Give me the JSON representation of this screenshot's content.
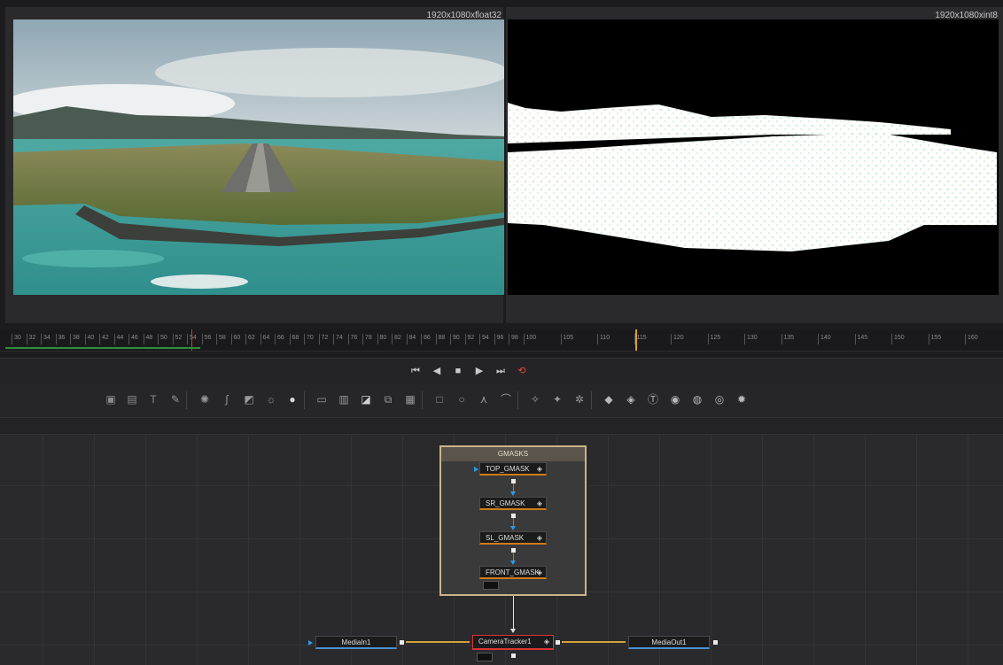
{
  "viewers": {
    "left": {
      "resolution": "1920x1080xfloat32"
    },
    "right": {
      "resolution": "1920x1080xint8"
    }
  },
  "ruler": {
    "ticks": [
      "30",
      "32",
      "34",
      "36",
      "38",
      "40",
      "42",
      "44",
      "46",
      "48",
      "50",
      "52",
      "54",
      "56",
      "58",
      "60",
      "62",
      "64",
      "66",
      "68",
      "70",
      "72",
      "74",
      "76",
      "78",
      "80",
      "82",
      "84",
      "86",
      "88",
      "90",
      "92",
      "94",
      "96",
      "98",
      "100",
      "105",
      "110",
      "115",
      "120",
      "125",
      "130",
      "135",
      "140",
      "145",
      "150",
      "155",
      "160"
    ]
  },
  "transport": {
    "icons": [
      "skip-to-start-icon",
      "step-back-icon",
      "stop-icon",
      "play-icon",
      "skip-to-end-icon",
      "loop-icon"
    ]
  },
  "toolbar": {
    "icons": [
      "background-icon",
      "image-icon",
      "text-icon",
      "paint-icon",
      "blur-icon",
      "color-curves-icon",
      "color-corrector-icon",
      "brightness-icon",
      "drop-icon",
      "merge-icon",
      "channel-booleans-icon",
      "matte-control-icon",
      "transform-icon",
      "resize-icon",
      "rectangle-mask-icon",
      "ellipse-mask-icon",
      "polygon-mask-icon",
      "bspline-mask-icon",
      "particle-emitter-icon",
      "particle-render-icon",
      "particle-icon",
      "shape3d-icon",
      "merge3d-icon",
      "text3d-icon",
      "camera3d-icon",
      "renderer3d-icon",
      "fbx-icon",
      "lights-icon"
    ]
  },
  "graph": {
    "group": {
      "title": "GMASKS"
    },
    "nodes": {
      "top_gmask": "TOP_GMASK",
      "sr_gmask": "SR_GMASK",
      "sl_gmask": "SL_GMASK",
      "front_gmask": "FRONT_GMASK",
      "mediain": "MediaIn1",
      "camera_tracker": "CameraTracker1",
      "mediaout": "MediaOut1"
    }
  },
  "colors": {
    "accent_orange": "#d07b1a",
    "selection_red": "#dd3333",
    "link_yellow": "#d2a23a",
    "input_blue": "#2a9ae8",
    "group_border": "#c9b48a"
  }
}
